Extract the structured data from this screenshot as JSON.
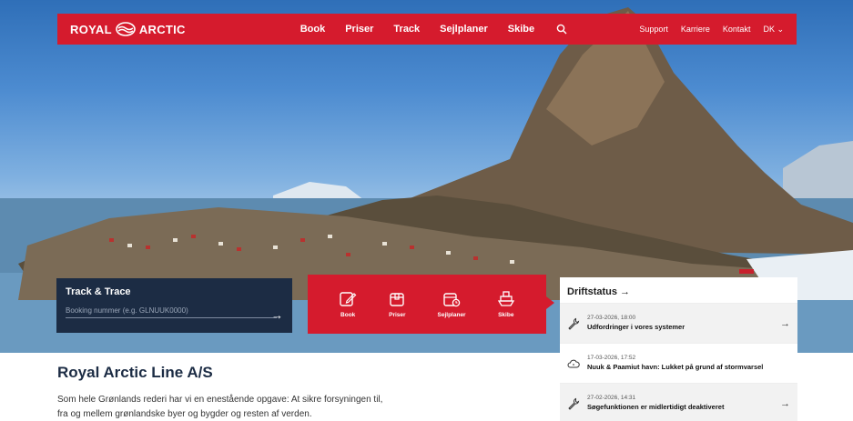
{
  "brand": {
    "logo_left": "ROYAL",
    "logo_right": "ARCTIC",
    "accent": "#d51b2d",
    "navy": "#1c2c44"
  },
  "nav": {
    "main": [
      "Book",
      "Priser",
      "Track",
      "Sejlplaner",
      "Skibe"
    ],
    "search_icon": "search-icon",
    "right": [
      "Support",
      "Karriere",
      "Kontakt",
      "DK ⌄"
    ]
  },
  "track": {
    "title": "Track & Trace",
    "placeholder": "Booking nummer (e.g. GLNUUK0000)"
  },
  "quick": [
    {
      "label": "Book",
      "icon": "edit-icon"
    },
    {
      "label": "Priser",
      "icon": "box-icon"
    },
    {
      "label": "Sejlplaner",
      "icon": "calendar-icon"
    },
    {
      "label": "Skibe",
      "icon": "ship-icon"
    }
  ],
  "drift": {
    "title": "Driftstatus →",
    "items": [
      {
        "date": "27-03-2026, 18:00",
        "title": "Udfordringer i vores systemer",
        "icon": "wrench-icon"
      },
      {
        "date": "17-03-2026, 17:52",
        "title": "Nuuk & Paamiut havn: Lukket på grund af stormvarsel",
        "icon": "cloud-icon"
      },
      {
        "date": "27-02-2026, 14:31",
        "title": "Søgefunktionen er midlertidigt deaktiveret",
        "icon": "wrench-icon"
      }
    ]
  },
  "intro": {
    "title": "Royal Arctic Line A/S",
    "text_line1": "Som hele Grønlands rederi har vi en enestående opgave: At sikre forsyningen til,",
    "text_line2": "fra og mellem grønlandske byer og bygder og resten af verden."
  }
}
